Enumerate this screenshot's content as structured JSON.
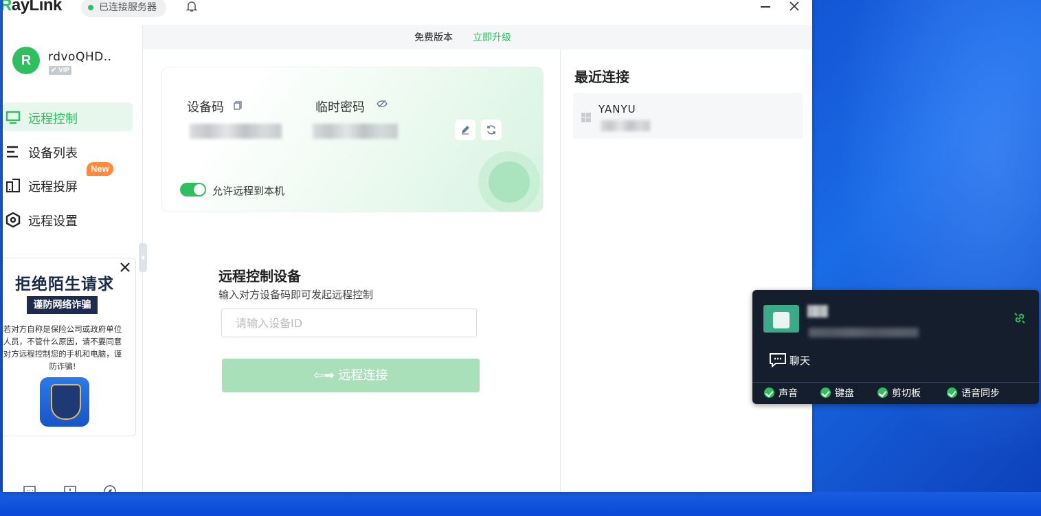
{
  "app": {
    "logo_prefix": "R",
    "logo_rest": "ayLink",
    "status": "已连接服务器"
  },
  "user": {
    "avatar_letter": "R",
    "name": "rdvoQHD..",
    "badge": "VIP"
  },
  "sidebar": {
    "items": [
      {
        "label": "远程控制",
        "icon": "monitor-icon",
        "active": true
      },
      {
        "label": "设备列表",
        "icon": "list-icon",
        "active": false
      },
      {
        "label": "远程投屏",
        "icon": "screen-cast-icon",
        "active": false
      },
      {
        "label": "远程设置",
        "icon": "settings-hexagon-icon",
        "active": false
      }
    ],
    "new_badge": "New"
  },
  "ad": {
    "title": "拒绝陌生请求",
    "tag": "谨防网络诈骗",
    "text": "若对方自称是保险公司或政府单位人员，不管什么原因，请不要同意对方远程控制您的手机和电脑，谨防诈骗!"
  },
  "upgrade": {
    "edition": "免费版本",
    "upgrade_link": "立即升级"
  },
  "device_card": {
    "device_code_label": "设备码",
    "temp_password_label": "临时密码",
    "allow_remote_label": "允许远程到本机",
    "allow_remote": true
  },
  "remote_control": {
    "title": "远程控制设备",
    "subtitle": "输入对方设备码即可发起远程控制",
    "input_placeholder": "请输入设备ID",
    "connect_label": "远程连接"
  },
  "recent": {
    "title": "最近连接",
    "items": [
      {
        "name": "YANYU",
        "os_icon": "windows-icon"
      }
    ]
  },
  "session_panel": {
    "chat_label": "聊天",
    "options": [
      {
        "label": "声音",
        "checked": true
      },
      {
        "label": "键盘",
        "checked": true
      },
      {
        "label": "剪切板",
        "checked": true
      },
      {
        "label": "语音同步",
        "checked": true
      }
    ]
  },
  "colors": {
    "accent": "#2fbf5f",
    "accent_light": "#e8f7ee",
    "connect_button_disabled": "#a9e0b9",
    "panel_bg": "#151e2d",
    "new_badge": "#ff8a3d",
    "desktop": "#0f47c9"
  }
}
